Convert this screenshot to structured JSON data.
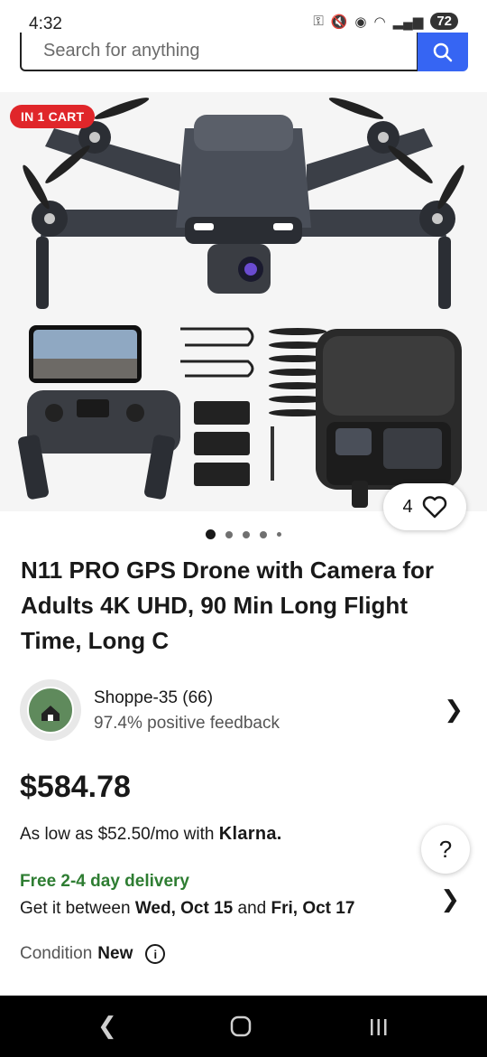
{
  "status_bar": {
    "time": "4:32",
    "battery": "72"
  },
  "search": {
    "placeholder": "Search for anything"
  },
  "product": {
    "cart_badge": "IN 1 CART",
    "watch_count": "4",
    "title": "N11 PRO GPS Drone with Camera for Adults 4K UHD, 90 Min Long Flight Time, Long C",
    "image_count": 5,
    "active_image": 1
  },
  "seller": {
    "avatar_text": "SHOPPE 35",
    "name": "Shoppe-35 (66)",
    "feedback": "97.4% positive feedback"
  },
  "price": {
    "value": "$584.78",
    "financing_prefix": "As low as $52.50/mo with",
    "financing_brand": "Klarna."
  },
  "delivery": {
    "title": "Free 2-4 day delivery",
    "prefix": "Get it between",
    "date_start": "Wed, Oct 15",
    "conjunction": "and",
    "date_end": "Fri, Oct 17"
  },
  "condition": {
    "label": "Condition",
    "value": "New"
  },
  "help": {
    "label": "?"
  },
  "colors": {
    "accent": "#3665f3",
    "badge": "#e0262a",
    "delivery": "#2e7d32"
  }
}
